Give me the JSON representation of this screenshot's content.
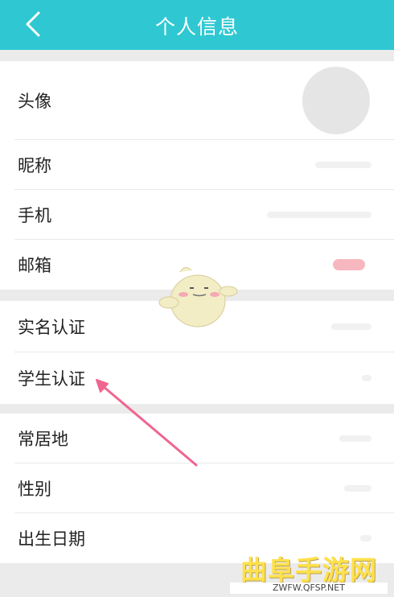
{
  "header": {
    "title": "个人信息",
    "back_icon": "chevron-left-icon"
  },
  "sections": [
    {
      "rows": [
        {
          "label": "头像"
        },
        {
          "label": "昵称"
        },
        {
          "label": "手机"
        },
        {
          "label": "邮箱"
        }
      ]
    },
    {
      "rows": [
        {
          "label": "实名认证"
        },
        {
          "label": "学生认证"
        }
      ]
    },
    {
      "rows": [
        {
          "label": "常居地"
        },
        {
          "label": "性别"
        },
        {
          "label": "出生日期"
        }
      ]
    }
  ],
  "watermark": {
    "title": "曲阜手游网",
    "url": "ZWFW.QFSP.NET"
  },
  "colors": {
    "header": "#2fc8d2",
    "arrow": "#f0658f",
    "watermark": "#ffe14a"
  }
}
